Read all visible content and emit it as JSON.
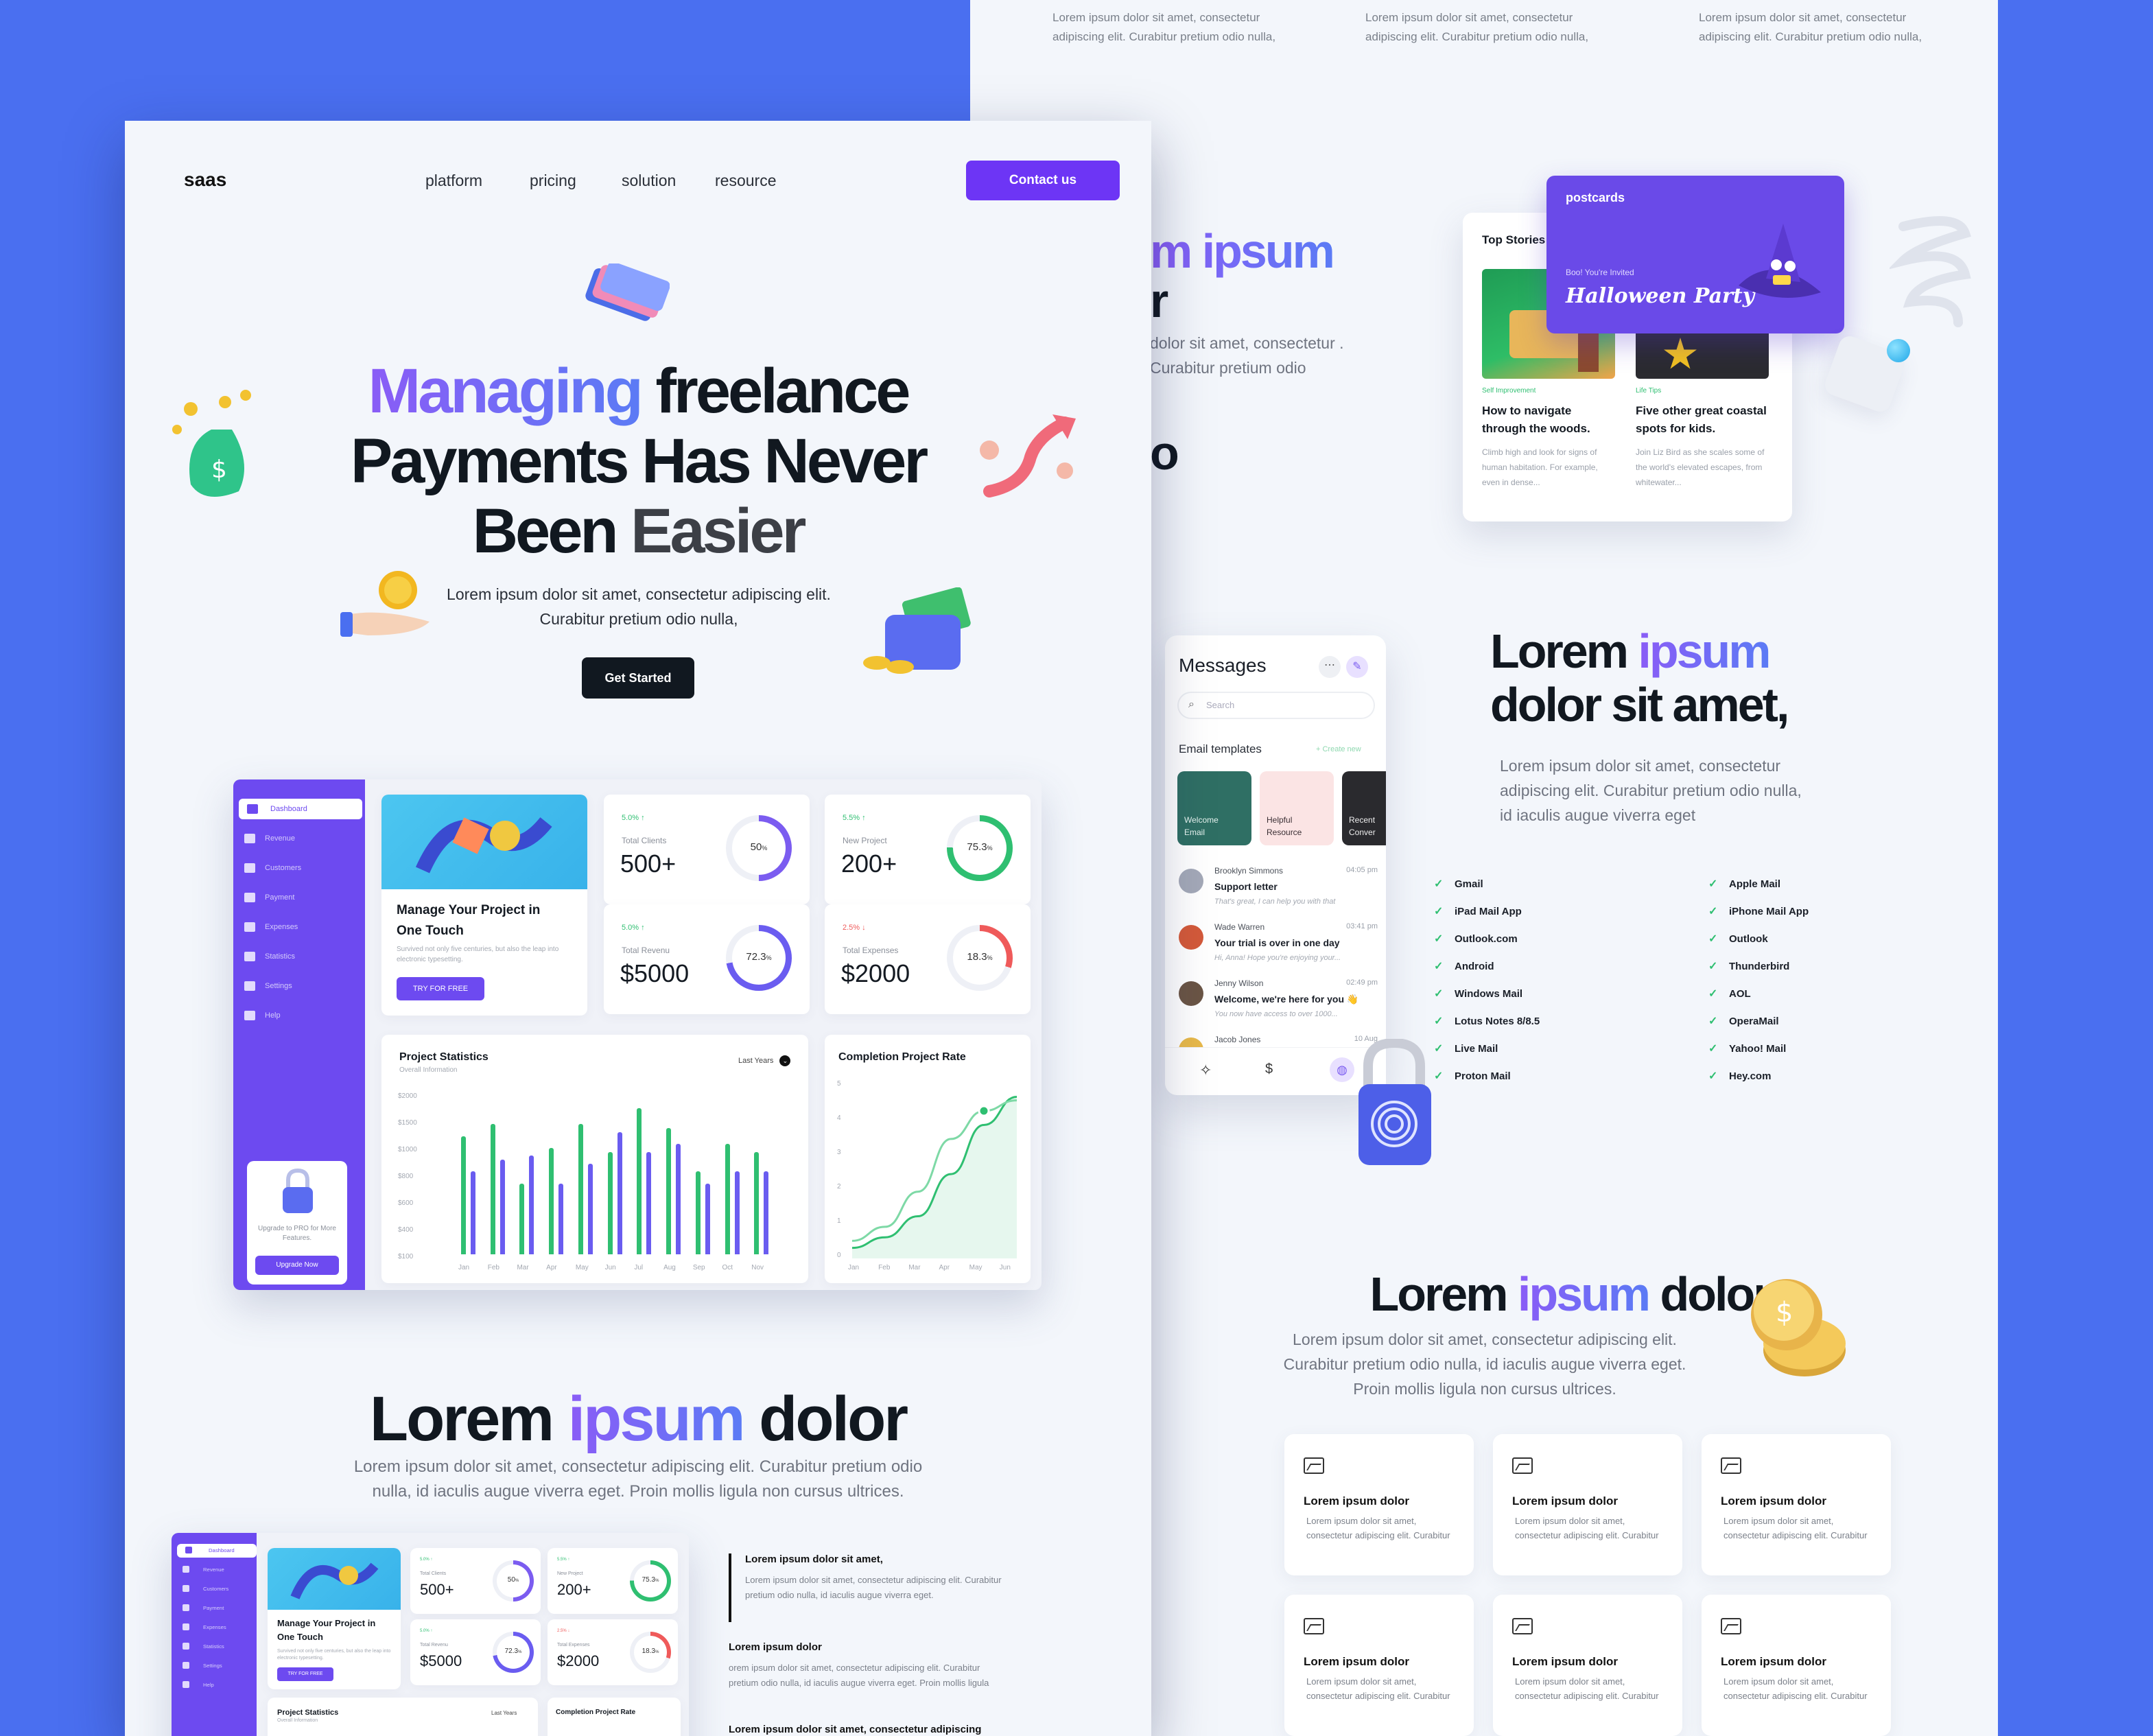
{
  "back": {
    "top_lorem": "Lorem ipsum dolor sit amet, consectetur adipiscing elit. Curabitur pretium odio nulla,",
    "partial_heading_1": "m ipsum",
    "partial_heading_2": "r",
    "partial_text": "dolor sit amet, consectetur . Curabitur pretium odio",
    "partial_letter": "o",
    "story_card": {
      "header": "Top Stories",
      "s1_tag": "Self Improvement",
      "s1_title": "How to navigate through the woods.",
      "s1_desc": "Climb high and look for signs of human habitation. For example, even in dense...",
      "s2_tag": "Life Tips",
      "s2_title": "Five other great coastal spots for kids.",
      "s2_desc": "Join Liz Bird as she scales some of the world's elevated escapes, from whitewater..."
    },
    "postcard": {
      "brand": "postcards",
      "invite": "Boo! You're Invited",
      "title": "Halloween Party"
    },
    "messages": {
      "title": "Messages",
      "search_placeholder": "Search",
      "templates_label": "Email templates",
      "create_new": "+ Create new",
      "templates": [
        "Welcome Email",
        "Helpful Resource",
        "Recent Conver"
      ],
      "items": [
        {
          "name": "Brooklyn Simmons",
          "time": "04:05 pm",
          "subject": "Support letter",
          "preview": "That's great, I can help you with that"
        },
        {
          "name": "Wade Warren",
          "time": "03:41 pm",
          "subject": "Your trial is over in one day",
          "preview": "Hi, Anna! Hope you're enjoying your..."
        },
        {
          "name": "Jenny Wilson",
          "time": "02:49 pm",
          "subject": "Welcome, we're here for you 👋",
          "preview": "You now have access to over 1000..."
        },
        {
          "name": "Jacob Jones",
          "time": "10 Aug",
          "subject": "",
          "preview": ""
        }
      ]
    },
    "clients": {
      "h1": "Lorem",
      "h1_accent": "ipsum",
      "h2": "dolor sit amet,",
      "desc": "Lorem ipsum dolor sit amet, consectetur adipiscing elit. Curabitur pretium odio nulla, id iaculis augue viverra eget",
      "col1": [
        "Gmail",
        "iPad Mail App",
        "Outlook.com",
        "Android",
        "Windows Mail",
        "Lotus Notes 8/8.5",
        "Live Mail",
        "Proton Mail"
      ],
      "col2": [
        "Apple Mail",
        "iPhone Mail App",
        "Outlook",
        "Thunderbird",
        "AOL",
        "OperaMail",
        "Yahoo! Mail",
        "Hey.com"
      ]
    },
    "features": {
      "h_a": "Lorem",
      "h_b": "ipsum",
      "h_c": "dolor",
      "desc": "Lorem ipsum dolor sit amet, consectetur adipiscing elit. Curabitur pretium odio nulla, id iaculis augue viverra eget. Proin mollis ligula non cursus ultrices.",
      "card_title": "Lorem ipsum dolor",
      "card_desc": "Lorem ipsum dolor sit amet, consectetur adipiscing elit. Curabitur",
      "partial_title": "um dolor",
      "partial_desc": "dolor sit amet, adipiscing elit."
    }
  },
  "front": {
    "logo": "saas",
    "nav": [
      "platform",
      "pricing",
      "solution",
      "resource"
    ],
    "contact": "Contact us",
    "hero": {
      "l1_accent": "Managing",
      "l1_rest": "freelance",
      "l2": "Payments Has Never",
      "l3_a": "Been",
      "l3_b": "Easier",
      "desc": "Lorem ipsum dolor sit amet, consectetur adipiscing elit. Curabitur pretium odio nulla,",
      "cta": "Get Started"
    },
    "dashboard": {
      "sidebar": [
        "Dashboard",
        "Revenue",
        "Customers",
        "Payment",
        "Expenses",
        "Statistics",
        "Settings",
        "Help"
      ],
      "promo_title": "Manage Your Project in One Touch",
      "promo_desc": "Survived not only five centuries, but also the leap into electronic typesetting.",
      "promo_btn": "TRY FOR FREE",
      "upgrade_text": "Upgrade to PRO for More Features.",
      "upgrade_btn": "Upgrade Now",
      "stats": [
        {
          "change": "5.0% ↑",
          "label": "Total Clients",
          "value": "500+",
          "pct": "50",
          "fill": 0.5,
          "color": "#7b5cf0"
        },
        {
          "change": "5.5% ↑",
          "label": "New Project",
          "value": "200+",
          "pct": "75.3",
          "fill": 0.753,
          "color": "#2fbf71"
        },
        {
          "change": "5.0% ↑",
          "label": "Total Revenu",
          "value": "$5000",
          "pct": "72.3",
          "fill": 0.723,
          "color": "#6a5cf0"
        },
        {
          "change": "2.5% ↓",
          "label": "Total Expenses",
          "value": "$2000",
          "pct": "18.3",
          "fill": 0.3,
          "color": "#ef5a5a"
        }
      ],
      "pct_suffix": "%",
      "proj_title": "Project Statistics",
      "proj_sub": "Overall Information",
      "proj_filter": "Last Years",
      "proj_y": [
        "$2000",
        "$1500",
        "$1000",
        "$800",
        "$600",
        "$400",
        "$100"
      ],
      "proj_x": [
        "Jan",
        "Feb",
        "Mar",
        "Apr",
        "May",
        "Jun",
        "Jul",
        "Aug",
        "Sep",
        "Oct",
        "Nov"
      ],
      "comp_title": "Completion Project Rate",
      "comp_y": [
        "5",
        "4",
        "3",
        "2",
        "1",
        "0"
      ],
      "comp_x": [
        "Jan",
        "Feb",
        "Mar",
        "Apr",
        "May",
        "Jun"
      ]
    },
    "section2": {
      "h_a": "Lorem",
      "h_b": "ipsum",
      "h_c": "dolor",
      "desc": "Lorem ipsum dolor sit amet, consectetur adipiscing elit. Curabitur pretium odio nulla, id iaculis augue viverra eget. Proin mollis ligula non cursus ultrices.",
      "b1_title": "Lorem ipsum dolor sit amet,",
      "b1_desc": "Lorem ipsum dolor sit amet, consectetur adipiscing elit. Curabitur pretium odio nulla, id iaculis augue viverra eget.",
      "b2_title": "Lorem ipsum dolor",
      "b2_desc": "orem ipsum dolor sit amet, consectetur adipiscing elit. Curabitur pretium odio nulla, id iaculis augue viverra eget. Proin mollis ligula",
      "b3_title": "Lorem ipsum dolor sit amet, consectetur adipiscing"
    }
  },
  "chart_data": [
    {
      "type": "bar",
      "title": "Project Statistics",
      "categories": [
        "Jan",
        "Feb",
        "Mar",
        "Apr",
        "May",
        "Jun",
        "Jul",
        "Aug",
        "Sep",
        "Oct",
        "Nov"
      ],
      "series": [
        {
          "values": [
            1500,
            1650,
            900,
            1350,
            1650,
            1300,
            1850,
            1600,
            1050,
            1400,
            1300
          ],
          "color": "#2fbf71"
        },
        {
          "values": [
            1050,
            1200,
            1250,
            900,
            1150,
            1550,
            1300,
            1400,
            900,
            1050,
            1050
          ],
          "color": "#6a5cf0"
        }
      ],
      "ylim": [
        0,
        2000
      ]
    },
    {
      "type": "line",
      "title": "Completion Project Rate",
      "x": [
        "Jan",
        "Feb",
        "Mar",
        "Apr",
        "May",
        "Jun"
      ],
      "series": [
        {
          "values": [
            0.3,
            0.6,
            1.2,
            2.4,
            3.8,
            4.6
          ],
          "color": "#2fbf71"
        },
        {
          "values": [
            0.5,
            0.9,
            1.9,
            3.4,
            4.2,
            4.5
          ],
          "color": "#7ed9a6"
        }
      ],
      "ylim": [
        0,
        5
      ]
    }
  ]
}
